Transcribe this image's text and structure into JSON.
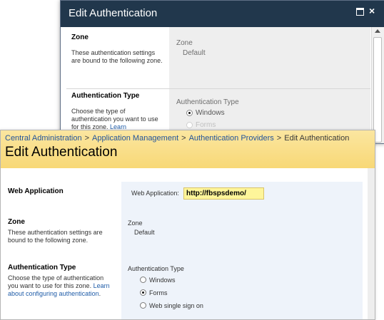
{
  "dialog": {
    "title": "Edit Authentication",
    "zone": {
      "label": "Zone",
      "description": "These authentication settings are bound to the following zone.",
      "value_label": "Zone",
      "value": "Default"
    },
    "auth_type": {
      "label": "Authentication Type",
      "description_prefix": "Choose the type of authentication you want to use for this zone.",
      "description_link": "Learn",
      "value_label": "Authentication Type",
      "options": [
        "Windows",
        "Forms"
      ],
      "selected": "Windows"
    }
  },
  "page": {
    "breadcrumb": [
      "Central Administration",
      "Application Management",
      "Authentication Providers",
      "Edit Authentication"
    ],
    "breadcrumb_separator": ">",
    "title": "Edit Authentication",
    "web_application": {
      "label": "Web Application",
      "field_label": "Web Application:",
      "value": "http://fbspsdemo/"
    },
    "zone": {
      "label": "Zone",
      "description": "These authentication settings are bound to the following zone.",
      "value_label": "Zone",
      "value": "Default"
    },
    "auth_type": {
      "label": "Authentication Type",
      "description_prefix": "Choose the type of authentication you want to use for this zone.",
      "description_link": "Learn about configuring authentication",
      "description_suffix": ".",
      "value_label": "Authentication Type",
      "options": [
        "Windows",
        "Forms",
        "Web single sign on"
      ],
      "selected": "Forms"
    }
  },
  "colors": {
    "dialog_title_bg": "#21374c",
    "header_bg": "#f8d876",
    "link": "#23549b",
    "url_highlight": "#fef59a",
    "right_panel_bg": "#eef3fa"
  }
}
